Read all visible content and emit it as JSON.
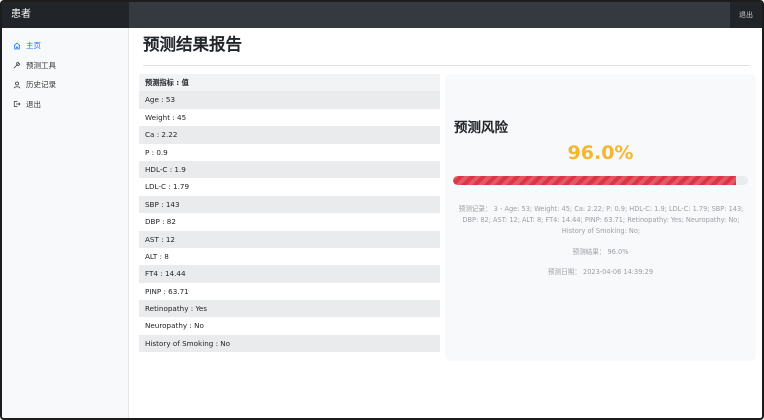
{
  "navbar": {
    "brand": "患者",
    "signout_label": "退出"
  },
  "sidebar": {
    "items": [
      {
        "label": "主页",
        "icon": "home-icon",
        "active": true
      },
      {
        "label": "预测工具",
        "icon": "wrench-icon",
        "active": false
      },
      {
        "label": "历史记录",
        "icon": "person-icon",
        "active": false
      },
      {
        "label": "退出",
        "icon": "box-arrow-right-icon",
        "active": false
      }
    ]
  },
  "main": {
    "title": "预测结果报告"
  },
  "table": {
    "header": "预测指标 : 值",
    "rows": [
      "Age : 53",
      "Weight : 45",
      "Ca : 2.22",
      "P : 0.9",
      "HDL-C : 1.9",
      "LDL-C : 1.79",
      "SBP : 143",
      "DBP : 82",
      "AST : 12",
      "ALT : 8",
      "FT4 : 14.44",
      "PINP : 63.71",
      "Retinopathy : Yes",
      "Neuropathy : No",
      "History of Smoking : No"
    ]
  },
  "result": {
    "title": "预测风险",
    "percentage": "96.0%",
    "progress_fraction": 0.96,
    "record_text": "预测记录： 3 - Age: 53; Weight: 45; Ca: 2.22; P: 0.9; HDL-C: 1.9; LDL-C: 1.79; SBP: 143; DBP: 82; AST: 12; ALT: 8; FT4: 14.44; PINP: 63.71; Retinopathy: Yes; Neuropathy: No; History of Smoking: No;",
    "outcome_text": "预测结果： 96.0%",
    "date_text": "预测日期： 2023-04-06 14:39:29"
  },
  "colors": {
    "navbar": "#343a40",
    "brand_bg": "#212529",
    "accent": "#0d6efd",
    "percentage": "#f6b62e",
    "progress_bar": "#dc3545"
  }
}
